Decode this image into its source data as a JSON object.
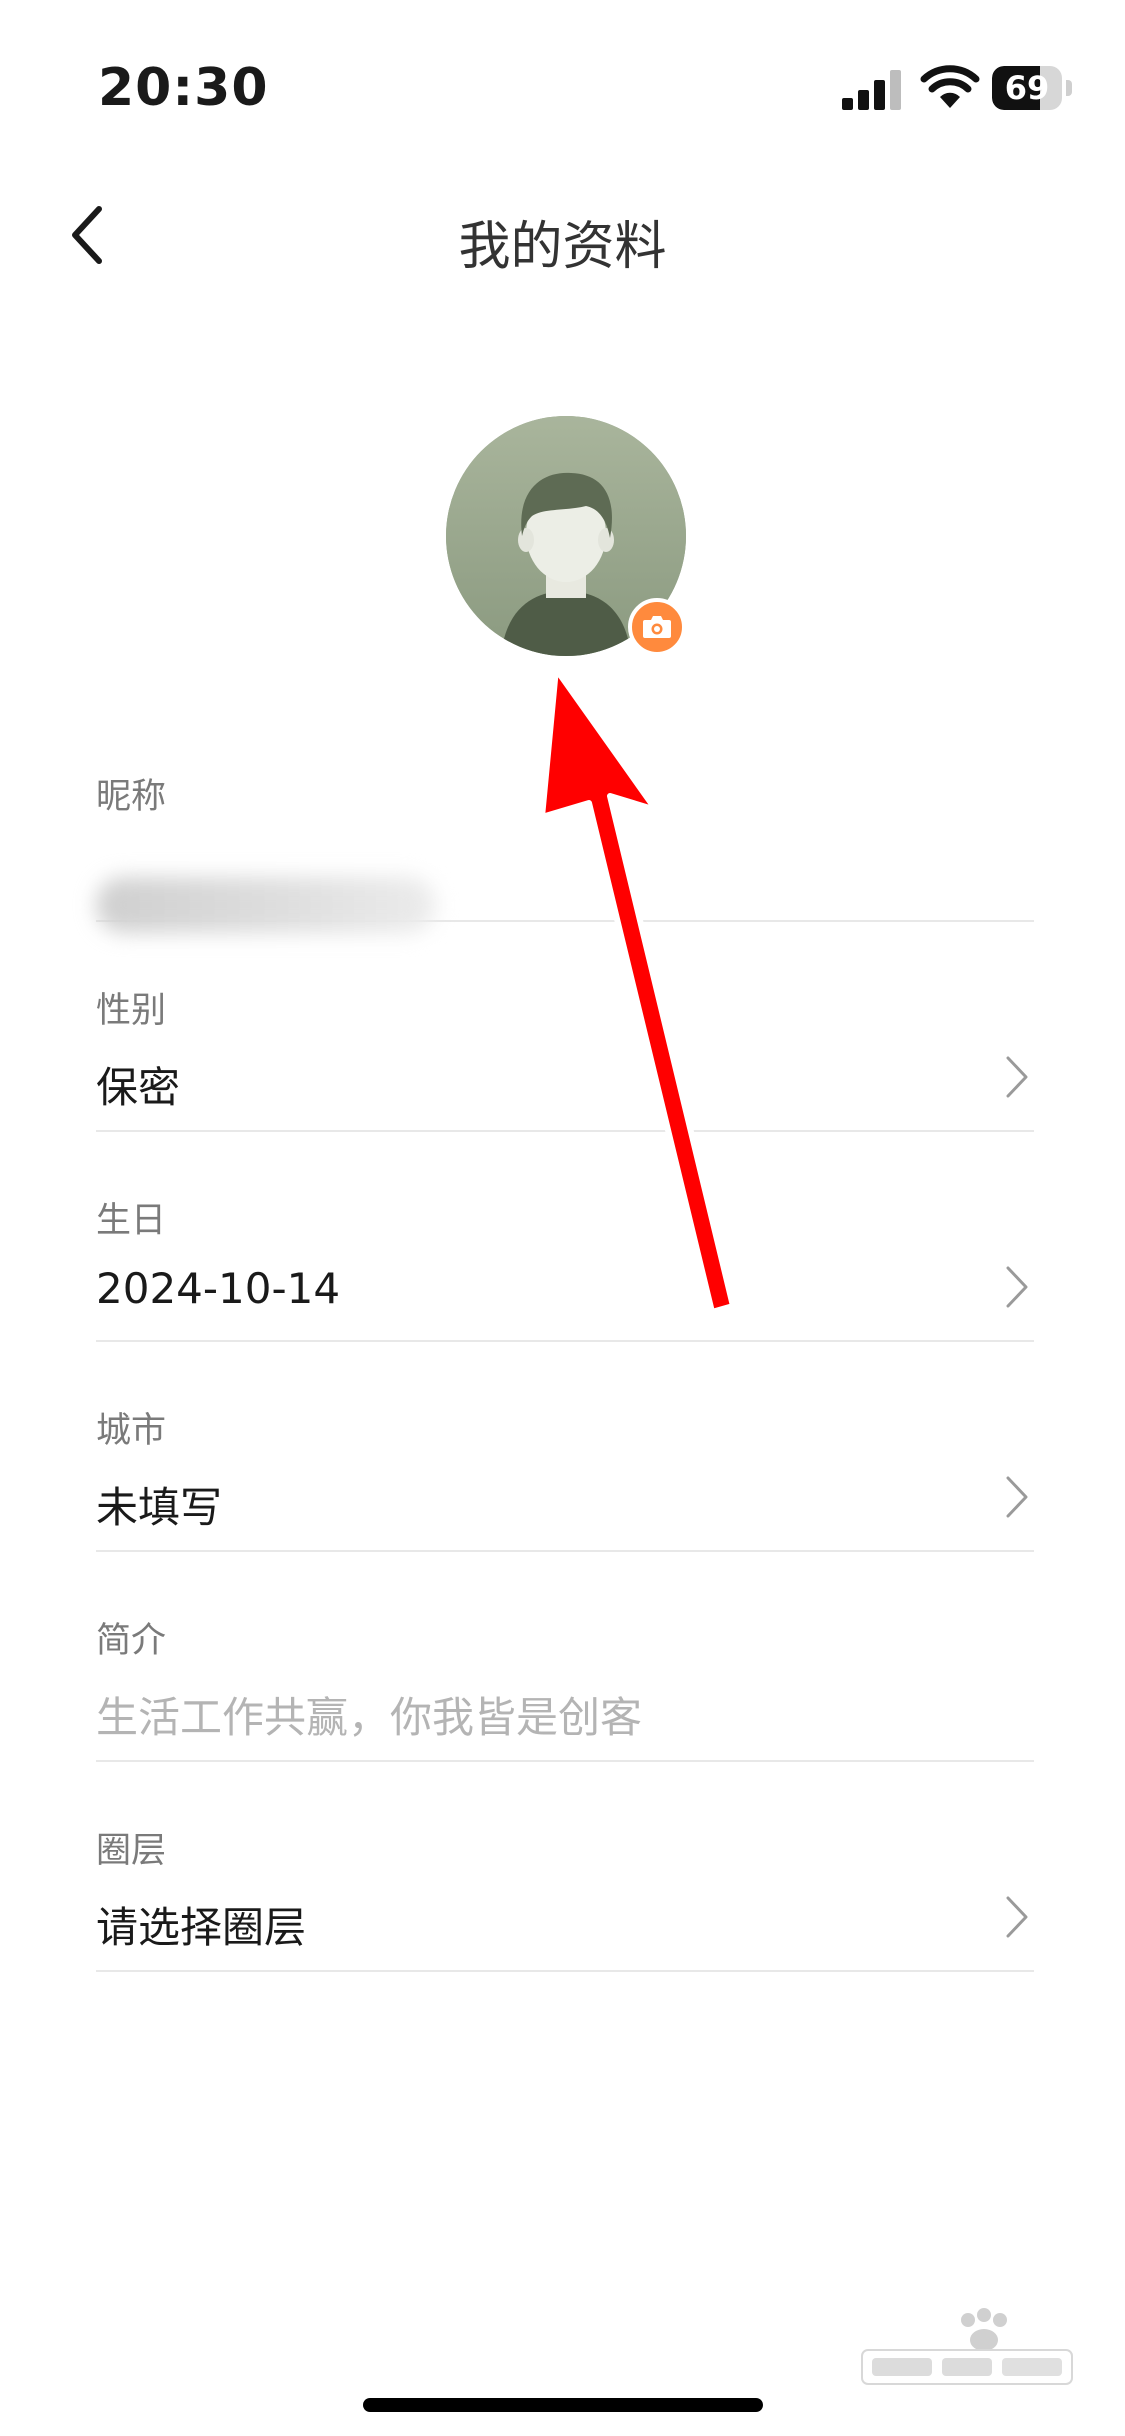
{
  "status_bar": {
    "time": "20:30",
    "battery_level": "69",
    "battery_fraction": 0.69,
    "icons": [
      "signal-icon",
      "wifi-icon",
      "battery-icon"
    ]
  },
  "nav": {
    "back_icon": "chevron-left-icon",
    "title": "我的资料"
  },
  "avatar": {
    "badge_icon": "camera-icon",
    "badge_color": "#ff8a3d"
  },
  "fields": [
    {
      "label": "昵称",
      "value": "",
      "blurred": true
    },
    {
      "label": "性别",
      "value": "保密",
      "chevron": true
    },
    {
      "label": "生日",
      "value": "2024-10-14",
      "chevron": true
    },
    {
      "label": "城市",
      "value": "未填写",
      "chevron": true
    },
    {
      "label": "简介",
      "placeholder": "生活工作共赢，你我皆是创客"
    },
    {
      "label": "圈层",
      "value": "请选择圈层",
      "chevron": true
    }
  ],
  "annotation": {
    "type": "red-arrow",
    "color": "#ff0000"
  },
  "watermark": {
    "logo": "baidu-jingyan-logo",
    "text": "jingyan.baidu.com"
  }
}
